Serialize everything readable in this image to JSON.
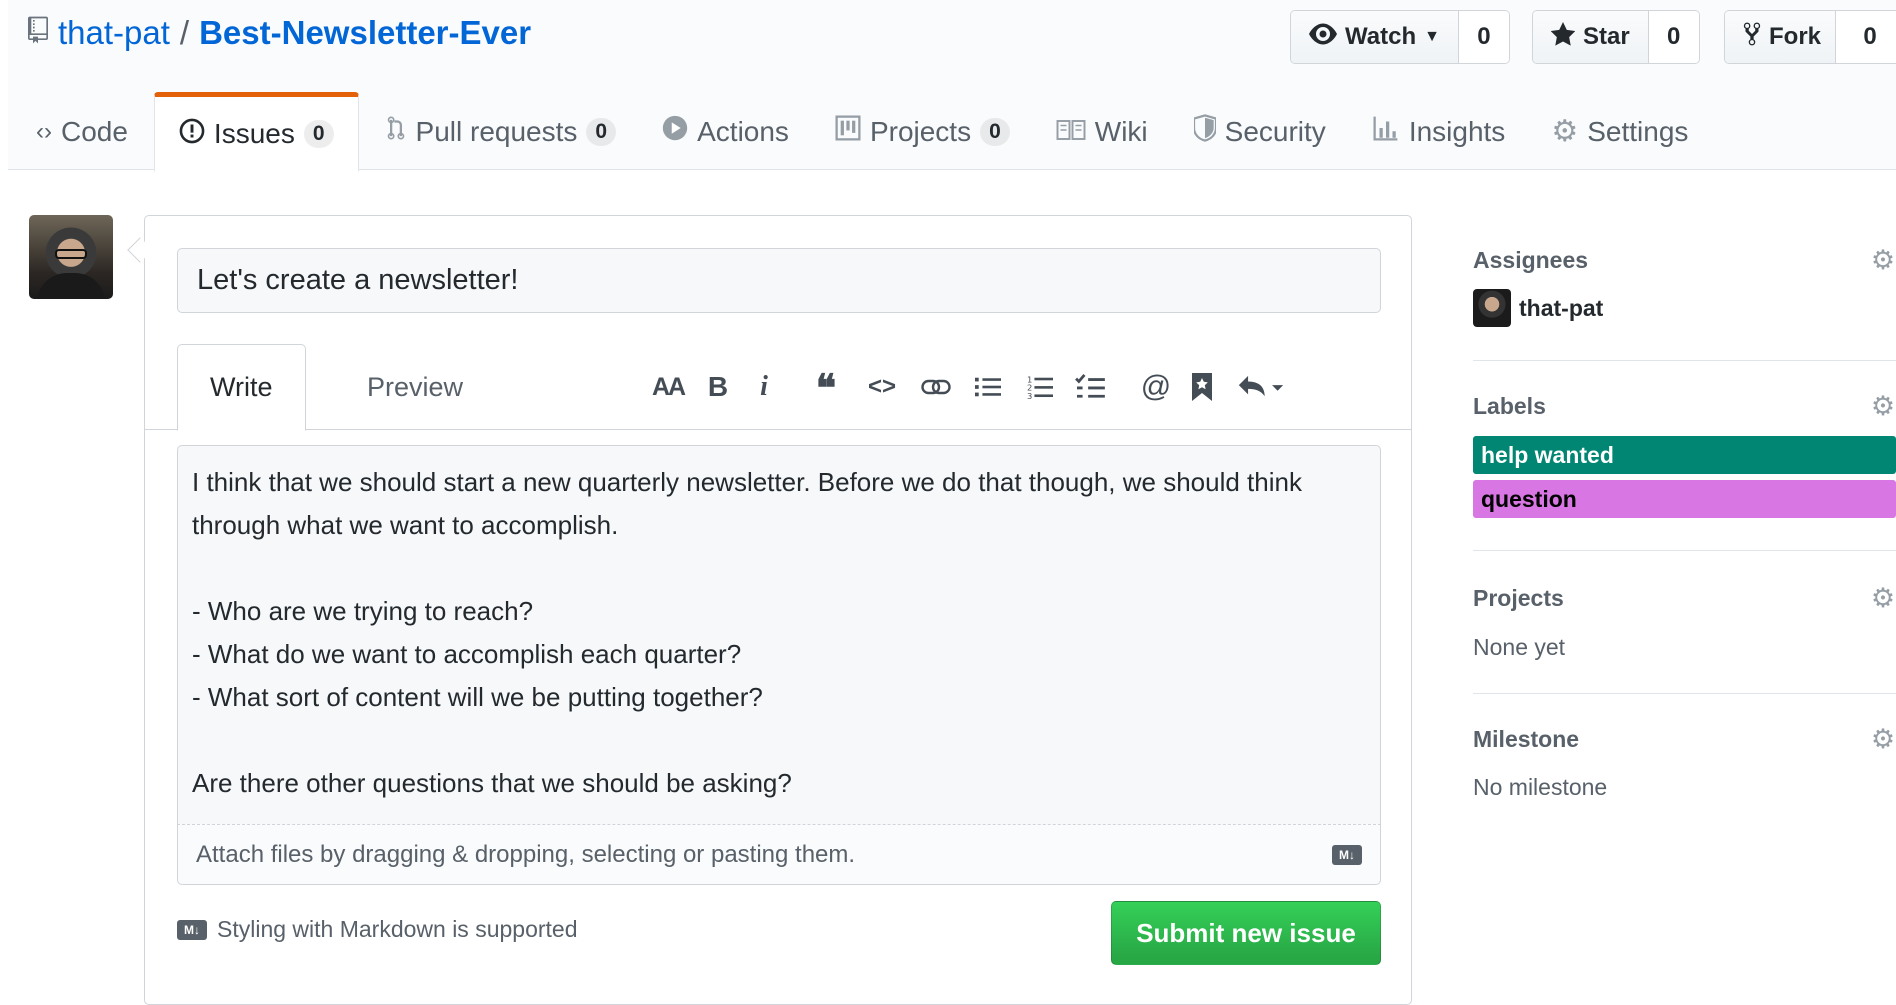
{
  "repo": {
    "owner": "that-pat",
    "separator": "/",
    "name": "Best-Newsletter-Ever"
  },
  "actions": [
    {
      "label": "Watch",
      "icon": "eye-icon",
      "count": "0",
      "dropdown": true
    },
    {
      "label": "Star",
      "icon": "star-icon",
      "count": "0"
    },
    {
      "label": "Fork",
      "icon": "fork-icon",
      "count": "0"
    }
  ],
  "tabs": [
    {
      "label": "Code",
      "icon": "code-icon"
    },
    {
      "label": "Issues",
      "icon": "issue-icon",
      "count": "0",
      "selected": true
    },
    {
      "label": "Pull requests",
      "icon": "pull-request-icon",
      "count": "0"
    },
    {
      "label": "Actions",
      "icon": "play-icon"
    },
    {
      "label": "Projects",
      "icon": "project-icon",
      "count": "0"
    },
    {
      "label": "Wiki",
      "icon": "book-icon"
    },
    {
      "label": "Security",
      "icon": "shield-icon"
    },
    {
      "label": "Insights",
      "icon": "graph-icon"
    },
    {
      "label": "Settings",
      "icon": "gear-icon"
    }
  ],
  "issue": {
    "title": "Let's create a newsletter!",
    "write_tab": "Write",
    "preview_tab": "Preview",
    "body": "I think that we should start a new quarterly newsletter. Before we do that though, we should think through what we want to accomplish.\n\n- Who are we trying to reach?\n- What do we want to accomplish each quarter?\n- What sort of content will we be putting together?\n\nAre there other questions that we should be asking?",
    "attach_hint": "Attach files by dragging & dropping, selecting or pasting them.",
    "markdown_note": "Styling with Markdown is supported",
    "markdown_badge": "M↓",
    "submit": "Submit new issue"
  },
  "toolbar": {
    "header_text": "AA",
    "bold": "B",
    "italic": "i",
    "quote": "❝",
    "code": "<>",
    "link": "⊖",
    "bulleted_list": "☰",
    "numbered_list": "⋮☰",
    "task_list": "✓☰",
    "mention": "@",
    "reference": "▮",
    "reply": "↶▾"
  },
  "sidebar": {
    "assignees": {
      "heading": "Assignees",
      "user": "that-pat"
    },
    "labels": {
      "heading": "Labels",
      "items": [
        {
          "name": "help wanted",
          "color": "#008672",
          "text_color": "#ffffff"
        },
        {
          "name": "question",
          "color": "#d876e3",
          "text_color": "#000000"
        }
      ]
    },
    "projects": {
      "heading": "Projects",
      "value": "None yet"
    },
    "milestone": {
      "heading": "Milestone",
      "value": "No milestone"
    }
  },
  "colors": {
    "accent_tab": "#e36209",
    "link": "#0366d6",
    "submit": "#2ea44f"
  }
}
